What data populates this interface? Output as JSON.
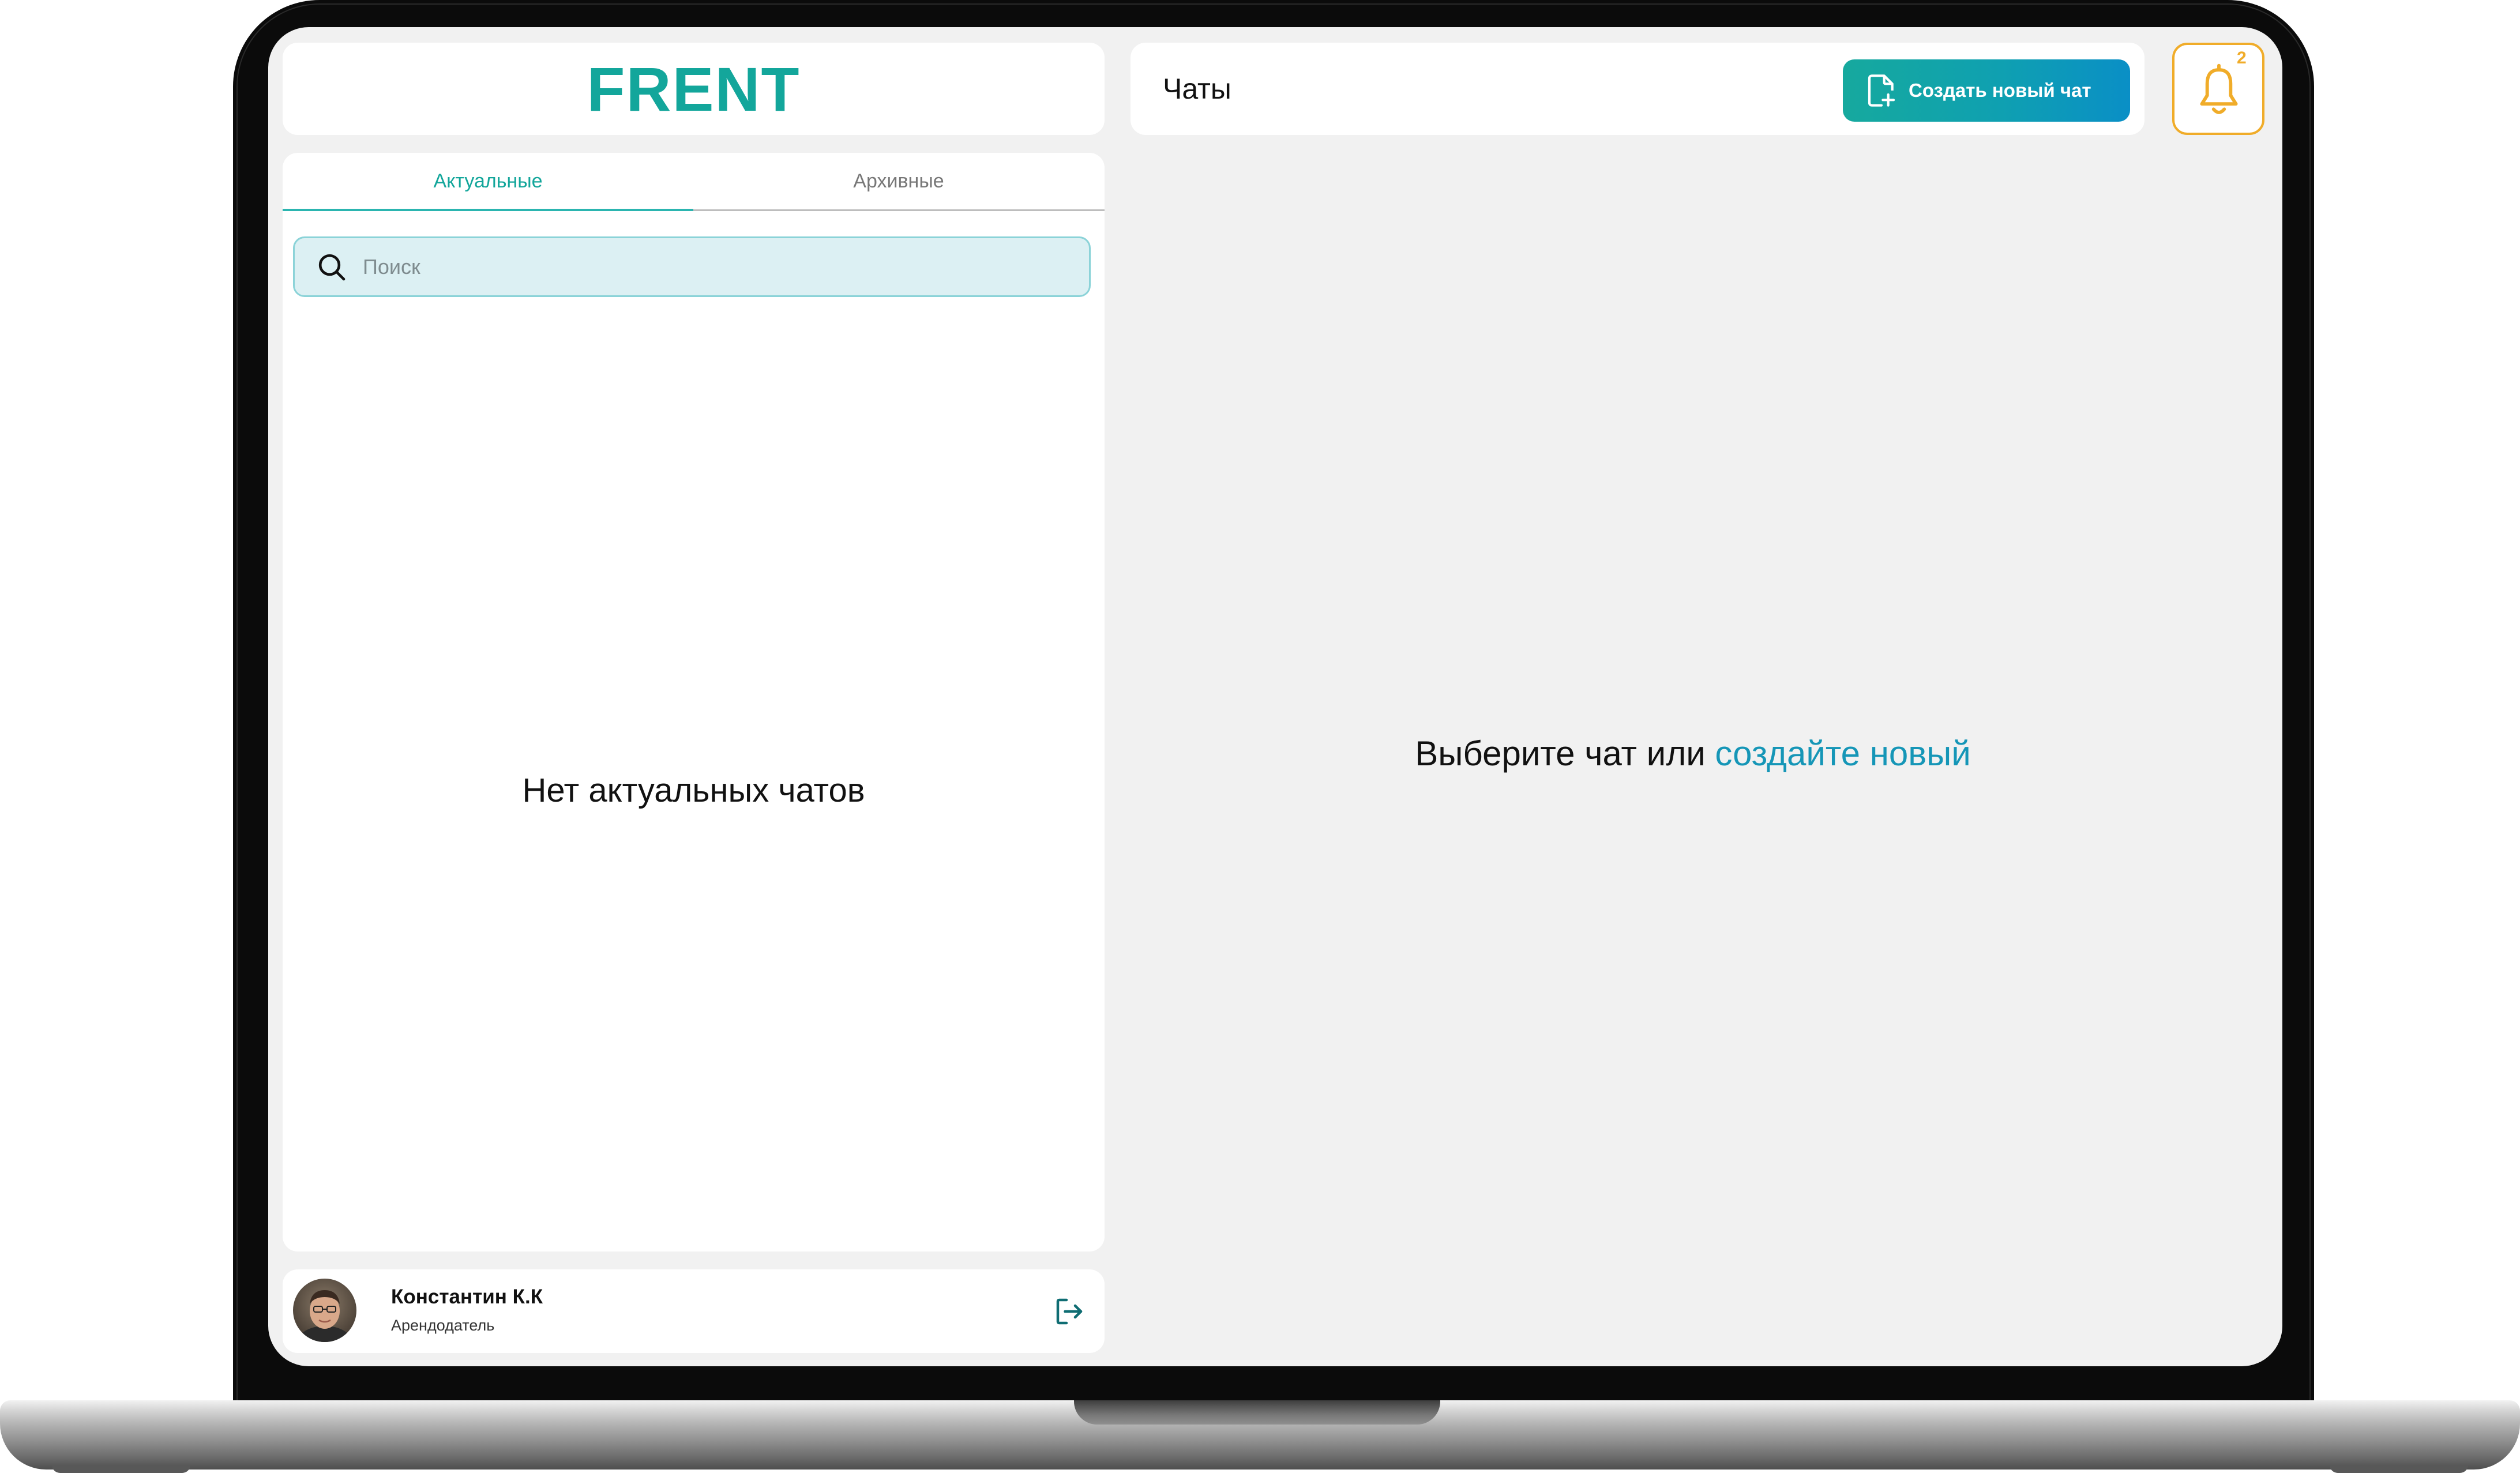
{
  "app": {
    "logo": "FRENT",
    "brand_color": "#13a69b"
  },
  "tabs": [
    {
      "label": "Актуальные",
      "active": true
    },
    {
      "label": "Архивные",
      "active": false
    }
  ],
  "search": {
    "placeholder": "Поиск",
    "value": ""
  },
  "chat_list": {
    "empty_text": "Нет актуальных чатов"
  },
  "user": {
    "name": "Константин К.К",
    "role": "Арендодатель",
    "avatar_icon": "user-photo",
    "logout_icon": "logout-icon"
  },
  "header": {
    "title": "Чаты",
    "create_button_label": "Создать новый чат",
    "create_button_icon": "file-plus-icon",
    "create_button_colors": [
      "#16a99e",
      "#0a8fc6"
    ]
  },
  "notifications": {
    "icon": "bell-icon",
    "count": "2",
    "accent_color": "#f0ac29"
  },
  "main": {
    "prompt_text": "Выберите чат или ",
    "prompt_link": "создайте новый",
    "link_color": "#1596b7"
  }
}
